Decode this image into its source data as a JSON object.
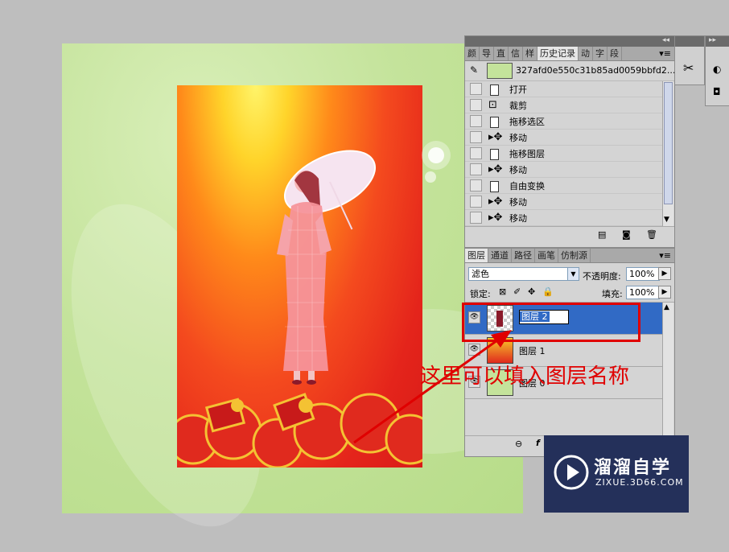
{
  "history_panel": {
    "tabs": [
      "颜",
      "导",
      "直",
      "信",
      "样",
      "历史记录",
      "动",
      "字",
      "段"
    ],
    "snapshot_name": "327afd0e550c31b85ad0059bbfd2...",
    "items": [
      {
        "label": "打开",
        "icon": "document-icon"
      },
      {
        "label": "裁剪",
        "icon": "crop-icon"
      },
      {
        "label": "拖移选区",
        "icon": "document-icon"
      },
      {
        "label": "移动",
        "icon": "move-icon"
      },
      {
        "label": "拖移图层",
        "icon": "document-icon"
      },
      {
        "label": "移动",
        "icon": "move-icon"
      },
      {
        "label": "自由变换",
        "icon": "document-icon"
      },
      {
        "label": "移动",
        "icon": "move-icon"
      },
      {
        "label": "移动",
        "icon": "move-icon"
      }
    ]
  },
  "layers_panel": {
    "tabs": [
      "图层",
      "通道",
      "路径",
      "画笔",
      "仿制源"
    ],
    "blend_mode": "滤色",
    "opacity_label": "不透明度:",
    "opacity_value": "100%",
    "lock_label": "锁定:",
    "fill_label": "填充:",
    "fill_value": "100%",
    "layers": [
      {
        "name": "图层 2",
        "selected": true,
        "editing": true
      },
      {
        "name": "图层 1",
        "selected": false,
        "editing": false
      },
      {
        "name": "图层 0",
        "selected": false,
        "editing": false
      }
    ]
  },
  "annotation": {
    "text": "这里可以填入图层名称",
    "color": "#e00000"
  },
  "watermark": {
    "brand": "溜溜自学",
    "url": "ZIXUE.3D66.COM"
  },
  "colors": {
    "selection": "#316ac5",
    "annotation_red": "#e00000",
    "panel_gray": "#d4d4d4"
  }
}
